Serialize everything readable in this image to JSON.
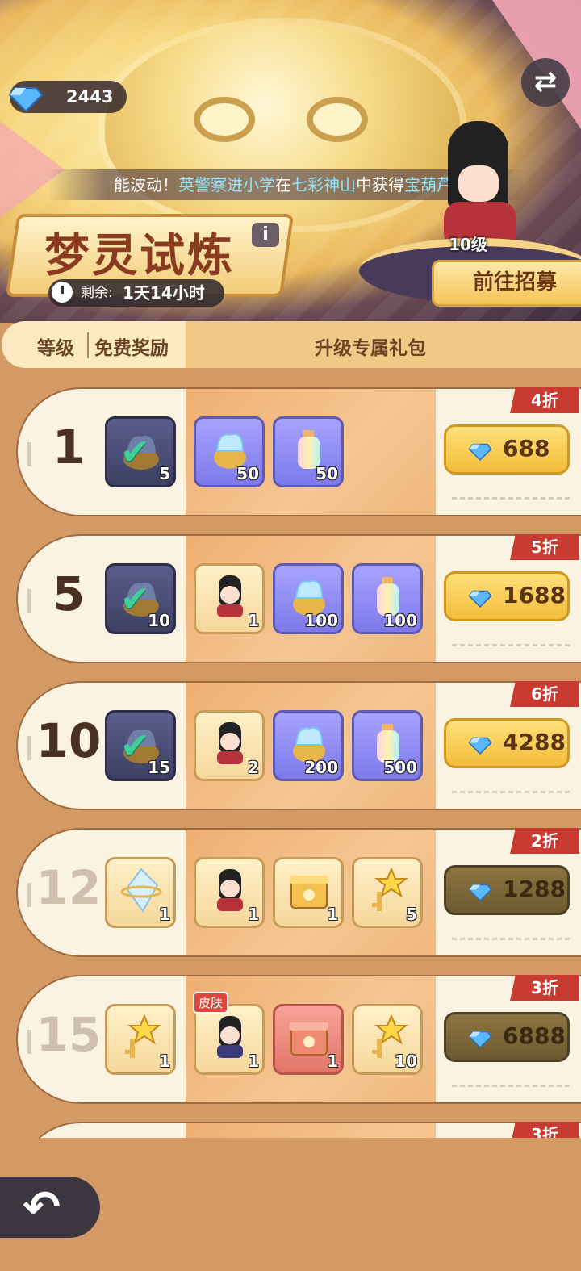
{
  "currency": {
    "value": "2443"
  },
  "marquee": {
    "p1": "能波动！",
    "p2": "英警察进小学",
    "p3": "在",
    "p4": "七彩神山",
    "p5": "中获得",
    "p6": "宝葫芦",
    "p7": "!"
  },
  "event": {
    "title": "梦灵试炼",
    "info": "i",
    "remaining_label": "剩余:",
    "remaining_value": "1天14小时"
  },
  "hero": {
    "level": "10级",
    "recruit_label": "前往招募"
  },
  "table_header": {
    "level": "等级",
    "free_reward": "免费奖励",
    "exclusive_pack": "升级专属礼包"
  },
  "rows": [
    {
      "level": "1",
      "discount": "4折",
      "price": "688",
      "locked": false,
      "items": [
        {
          "icon": "chest-checked-icon",
          "qty": "5",
          "style": "dark"
        },
        {
          "icon": "blue-flame-pot-icon",
          "qty": "50",
          "style": "purple"
        },
        {
          "icon": "rainbow-bottle-icon",
          "qty": "50",
          "style": "purple"
        }
      ]
    },
    {
      "level": "5",
      "discount": "5折",
      "price": "1688",
      "locked": false,
      "items": [
        {
          "icon": "chest-checked-icon",
          "qty": "10",
          "style": "dark"
        },
        {
          "icon": "hero-portrait-icon",
          "qty": "1",
          "style": "gold"
        },
        {
          "icon": "blue-flame-pot-icon",
          "qty": "100",
          "style": "purple"
        },
        {
          "icon": "rainbow-bottle-icon",
          "qty": "100",
          "style": "purple"
        }
      ]
    },
    {
      "level": "10",
      "discount": "6折",
      "price": "4288",
      "locked": false,
      "items": [
        {
          "icon": "chest-checked-icon",
          "qty": "15",
          "style": "dark"
        },
        {
          "icon": "hero-portrait-icon",
          "qty": "2",
          "style": "gold"
        },
        {
          "icon": "blue-flame-pot-icon",
          "qty": "200",
          "style": "purple"
        },
        {
          "icon": "rainbow-bottle-icon",
          "qty": "500",
          "style": "purple"
        }
      ]
    },
    {
      "level": "12",
      "discount": "2折",
      "price": "1288",
      "locked": true,
      "items": [
        {
          "icon": "crystal-shard-icon",
          "qty": "1",
          "style": "gold"
        },
        {
          "icon": "hero-portrait-icon",
          "qty": "1",
          "style": "gold"
        },
        {
          "icon": "golden-box-icon",
          "qty": "1",
          "style": "gold"
        },
        {
          "icon": "star-key-icon",
          "qty": "5",
          "style": "gold"
        }
      ]
    },
    {
      "level": "15",
      "discount": "3折",
      "price": "6888",
      "locked": true,
      "items": [
        {
          "icon": "star-key-icon",
          "qty": "1",
          "style": "gold"
        },
        {
          "icon": "skin-portrait-icon",
          "qty": "1",
          "style": "gold",
          "tag": "皮肤"
        },
        {
          "icon": "red-box-icon",
          "qty": "1",
          "style": "red"
        },
        {
          "icon": "star-key-icon",
          "qty": "10",
          "style": "gold"
        }
      ]
    },
    {
      "level": "",
      "discount": "3折",
      "price": "",
      "locked": true,
      "items": []
    }
  ],
  "colors": {
    "accent_gold": "#f3bd3b",
    "discount_red": "#c93a31",
    "highlight_blue": "#8fe3ff"
  }
}
